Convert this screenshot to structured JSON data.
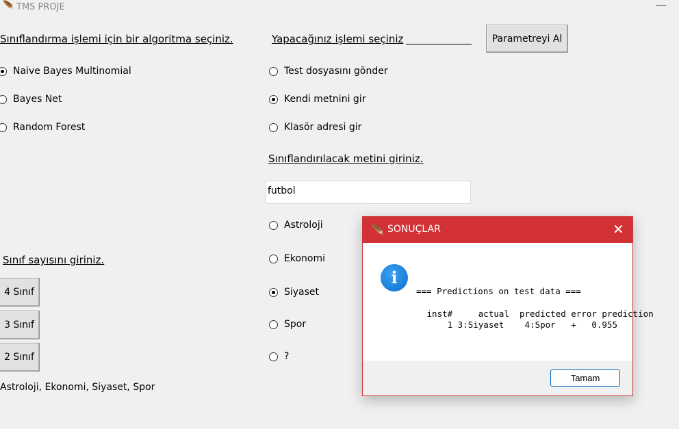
{
  "window": {
    "title": "TMS PROJE",
    "minimize_glyph": "—"
  },
  "algorithm": {
    "heading": "Sınıflandırma işlemi için bir algoritma seçiniz.",
    "options": [
      {
        "label": "Naive Bayes Multinomial",
        "checked": true
      },
      {
        "label": "Bayes Net",
        "checked": false
      },
      {
        "label": "Random Forest",
        "checked": false
      }
    ]
  },
  "operation": {
    "heading": "Yapacağınız işlemi seçiniz",
    "options": [
      {
        "label": "Test dosyasını gönder",
        "checked": false
      },
      {
        "label": "Kendi metnini gir",
        "checked": true
      },
      {
        "label": "Klasör adresi gir",
        "checked": false
      }
    ]
  },
  "param_button": "Parametreyi Al",
  "text_entry": {
    "heading": "Sınıflandırılacak metini giriniz.",
    "value": "futbol"
  },
  "classes": {
    "options": [
      {
        "label": "Astroloji",
        "checked": false
      },
      {
        "label": "Ekonomi",
        "checked": false
      },
      {
        "label": "Siyaset",
        "checked": true
      },
      {
        "label": "Spor",
        "checked": false
      },
      {
        "label": "?",
        "checked": false
      }
    ]
  },
  "class_count": {
    "heading": "Sınıf sayısını giriniz.",
    "buttons": [
      "4 Sınıf",
      "3 Sınıf",
      "2 Sınıf"
    ],
    "summary": "Astroloji, Ekonomi, Siyaset, Spor"
  },
  "dialog": {
    "title": "SONUÇLAR",
    "close_glyph": "✕",
    "info_glyph": "i",
    "line1": "=== Predictions on test data ===",
    "line2": " inst#     actual  predicted error prediction",
    "line3": "     1 3:Siyaset    4:Spor   +   0.955",
    "ok_label": "Tamam"
  },
  "colors": {
    "dialog_accent": "#d23236",
    "info_blue": "#0b6fcf",
    "ok_border": "#0067c0"
  }
}
